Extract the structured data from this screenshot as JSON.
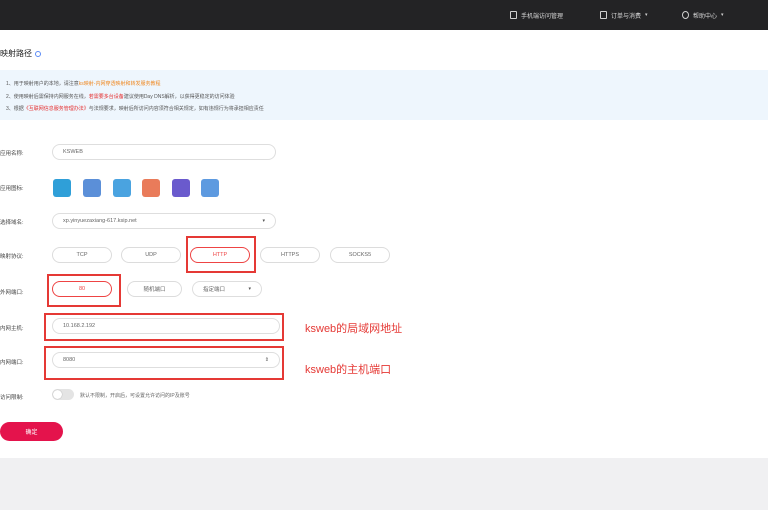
{
  "topbar": {
    "items": [
      {
        "label": "手机端访问管理",
        "icon": "phone-icon",
        "has_arrow": false
      },
      {
        "label": "订单与消费",
        "icon": "order-icon",
        "has_arrow": true
      },
      {
        "label": "帮助中心",
        "icon": "headset-icon",
        "has_arrow": true
      }
    ]
  },
  "page": {
    "title": "映射路径"
  },
  "notice": {
    "line1_prefix": "1、用于映射用户的本地，请注意",
    "line1_highlight": "ks映射-内网穿透映射和转发服务教程",
    "line2_prefix": "2、使用映射后需保持内网服务在线，",
    "line2_highlight": "若需要多台设备",
    "line2_suffix": "建议使用Day DNS解析，以获得更稳定的访问体验",
    "line3_prefix": "3、根据",
    "line3_highlight": "《互联网信息服务管理办法》",
    "line3_suffix": "与法规要求，映射后所访问内容须符合相关规定，如有违规行为将承担相应责任"
  },
  "form": {
    "app_name": {
      "label": "应用名称:",
      "value": "KSWEB"
    },
    "app_icon": {
      "label": "应用图标:"
    },
    "domain": {
      "label": "选择域名:",
      "value": "xp.yinyuezaxiang-617.ksip.net"
    },
    "protocol": {
      "label": "映射协议:",
      "options": [
        "TCP",
        "UDP",
        "HTTP",
        "HTTPS",
        "SOCKS5"
      ],
      "selected": "HTTP"
    },
    "port": {
      "label": "外网端口:",
      "value": "80",
      "option2": "随机端口",
      "option3": "指定端口"
    },
    "host": {
      "label": "内网主机:",
      "value": "10.168.2.192"
    },
    "local_port": {
      "label": "内网端口:",
      "value": "8080"
    },
    "access_limit": {
      "label": "访问限制:",
      "description": "默认不限制，开启后，可设置允许访问的IP及账号"
    }
  },
  "annotations": {
    "host": "ksweb的局域网地址",
    "port": "ksweb的主机端口"
  },
  "submit_label": "确定",
  "colors": {
    "accent": "#e4134c",
    "annotation_red": "#e53935",
    "topbar_bg": "#232325",
    "notice_bg": "#eef6fd"
  }
}
